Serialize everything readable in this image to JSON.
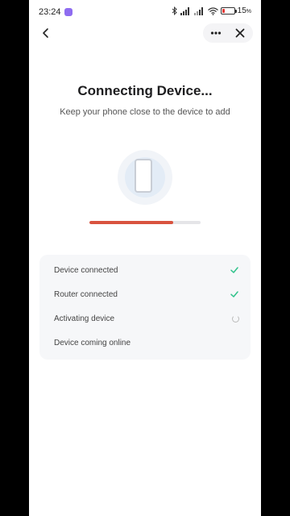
{
  "status_bar": {
    "time": "23:24",
    "battery": "15",
    "battery_unit": "%",
    "icons": [
      "app-notification-icon",
      "bluetooth-icon",
      "signal-icon",
      "signal-icon",
      "wifi-icon",
      "battery-icon"
    ]
  },
  "nav": {
    "back_icon": "back-chevron-icon",
    "more_icon": "more-dots-icon",
    "close_icon": "close-icon"
  },
  "header": {
    "title": "Connecting Device...",
    "subtitle": "Keep your phone close to the device to add"
  },
  "progress": {
    "value_percent": 75,
    "color": "#d9533f"
  },
  "steps": [
    {
      "label": "Device connected",
      "state": "done"
    },
    {
      "label": "Router connected",
      "state": "done"
    },
    {
      "label": "Activating device",
      "state": "loading"
    },
    {
      "label": "Device coming online",
      "state": "pending"
    }
  ],
  "colors": {
    "check": "#2fc28a",
    "accent": "#d9533f"
  }
}
